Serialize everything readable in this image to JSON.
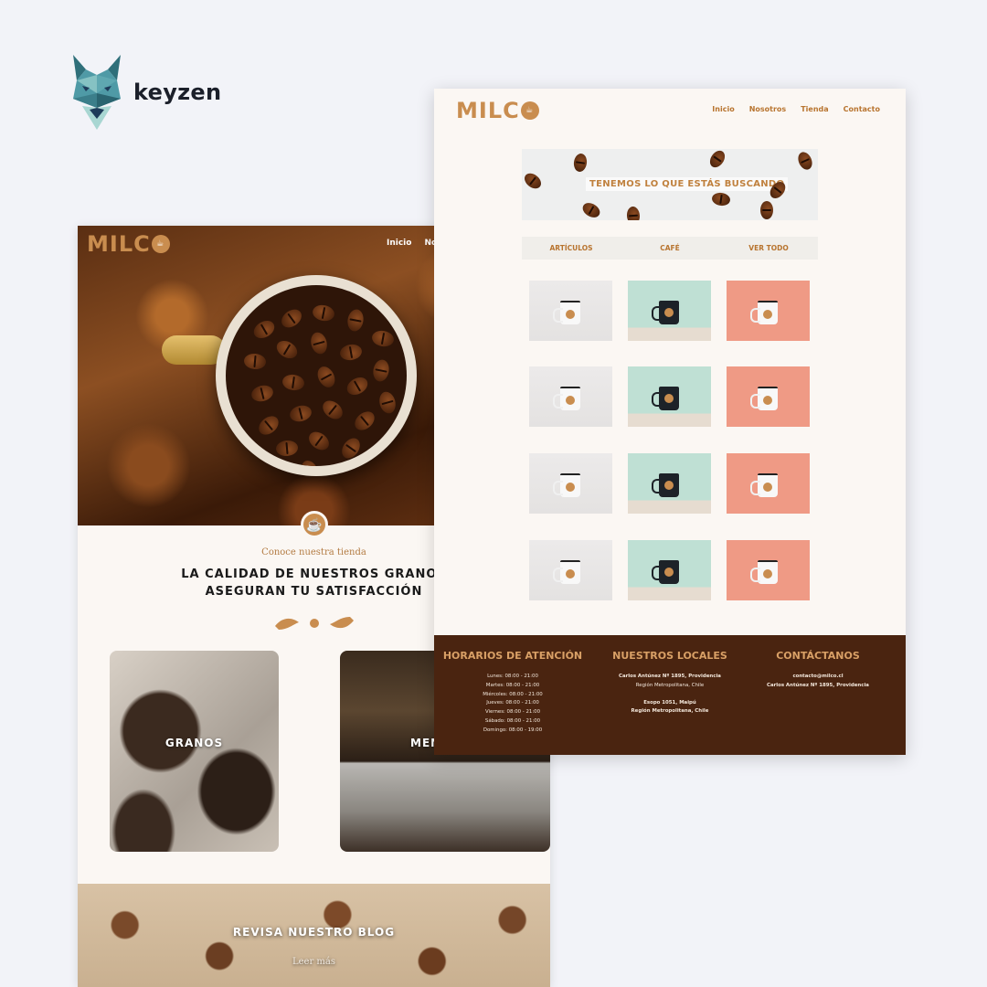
{
  "brand": {
    "name": "keyzen"
  },
  "home": {
    "logo_text": "MILC",
    "nav": [
      "Inicio",
      "Noso"
    ],
    "kicker": "Conoce nuestra tienda",
    "title_line1": "LA CALIDAD DE NUESTROS GRANOS",
    "title_line2": "ASEGURAN TU SATISFACCIÓN",
    "cards": [
      {
        "label": "GRANOS"
      },
      {
        "label": "MEN"
      }
    ],
    "blog": {
      "title": "REVISA NUESTRO BLOG",
      "link": "Leer más"
    }
  },
  "store": {
    "logo_text": "MILC",
    "nav": [
      "Inicio",
      "Nosotros",
      "Tienda",
      "Contacto"
    ],
    "banner_text": "TENEMOS LO QUE ESTÁS BUSCANDO",
    "filters": [
      "ARTÍCULOS",
      "CAFÉ",
      "VER TODO"
    ],
    "products": [
      [
        "white",
        "green",
        "coral"
      ],
      [
        "white",
        "green",
        "coral"
      ],
      [
        "white",
        "green",
        "coral"
      ],
      [
        "white",
        "green",
        "coral"
      ]
    ],
    "footer": {
      "hours": {
        "title": "HORARIOS DE ATENCIÓN",
        "lines": [
          "Lunes: 08:00 - 21:00",
          "Martes: 08:00 - 21:00",
          "Miércoles: 08:00 - 21:00",
          "Jueves: 08:00 - 21:00",
          "Viernes: 08:00 - 21:00",
          "Sábado: 08:00 - 21:00",
          "Domingo: 08:00 - 19:00"
        ]
      },
      "locations": {
        "title": "NUESTROS LOCALES",
        "loc1_line1": "Carlos Antúnez Nº 1895, Providencia",
        "loc1_line2": "Región Metropolitana, Chile",
        "loc2_line1": "Esopo 1051, Maipú",
        "loc2_line2": "Región Metropolitana, Chile"
      },
      "contact": {
        "title": "CONTÁCTANOS",
        "email": "contacto@milco.cl",
        "address": "Carlos Antúnez Nº 1895, Providencia"
      }
    }
  },
  "colors": {
    "accent": "#c98d4f",
    "nav": "#b8742f",
    "footer": "#4a2410",
    "footer_title": "#d9a066"
  }
}
